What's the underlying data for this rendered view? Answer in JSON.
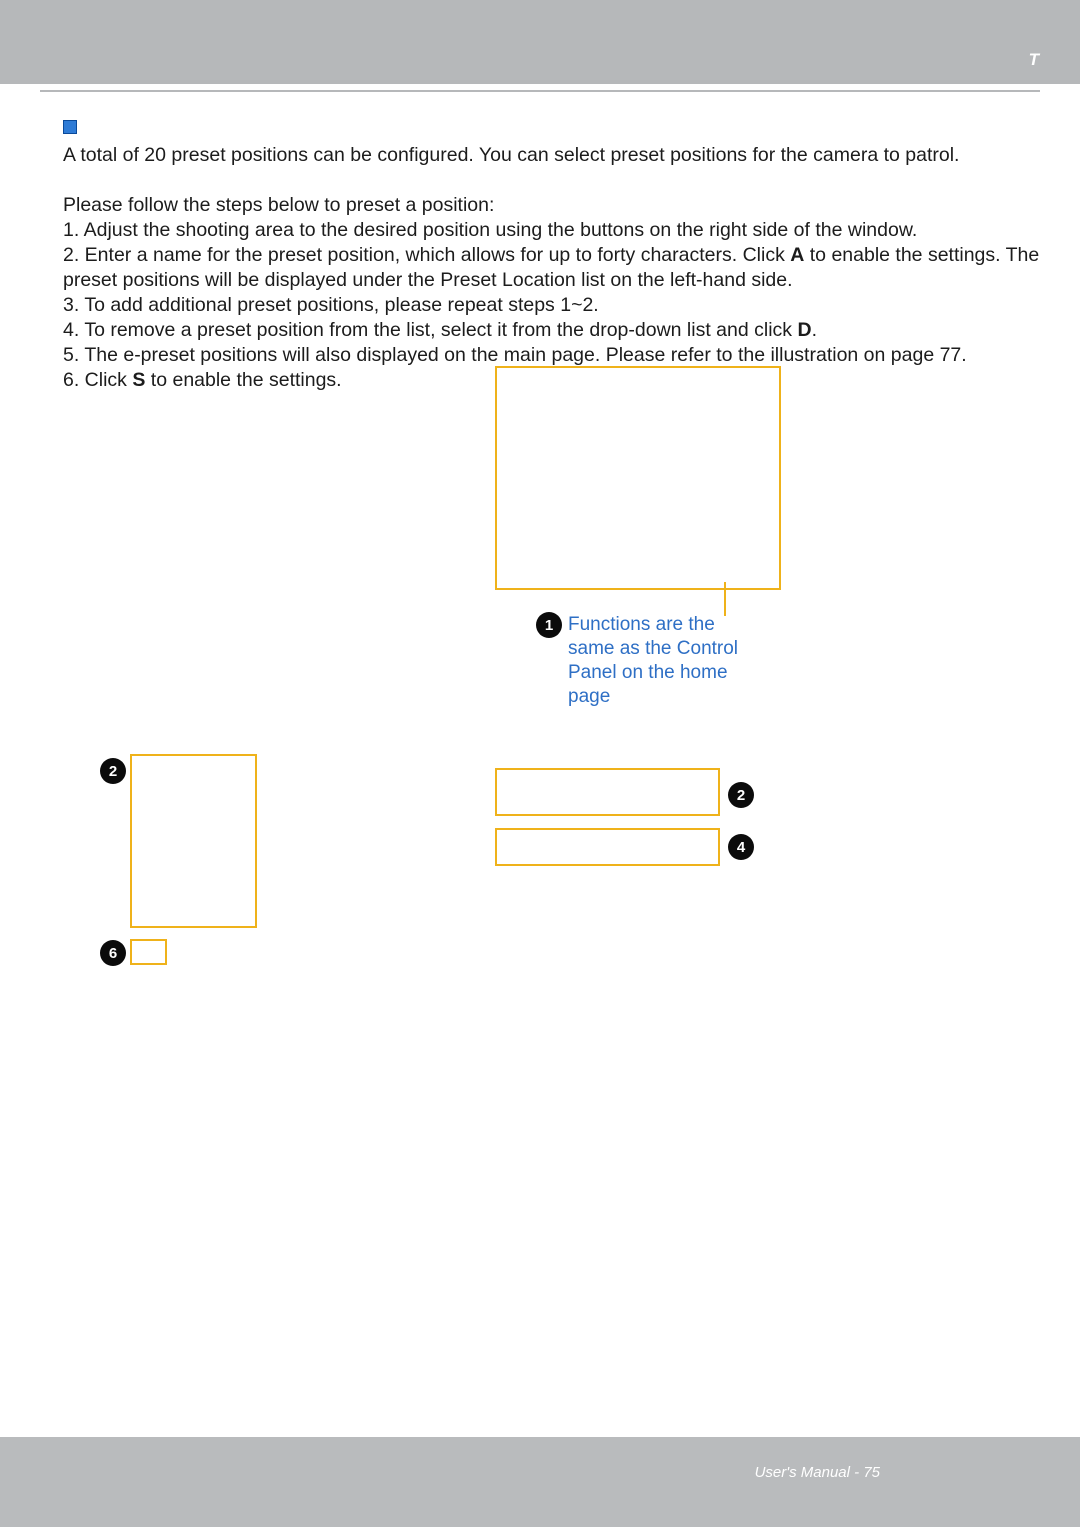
{
  "header": {
    "section_title": "T"
  },
  "intro_line": "A total of 20 preset positions can be configured. You can select preset positions for the camera to patrol.",
  "steps_intro": "Please follow the steps below to preset a position:",
  "steps": {
    "s1": "1. Adjust the shooting area to the desired position using the buttons on the right side of the window.",
    "s2_a": "2. Enter a name for the preset position, which allows for up to forty characters. Click ",
    "s2_marker": "A",
    "s2_b": " to enable the settings. The preset positions will be displayed under the Preset Location list on the left-hand side.",
    "s3": "3. To add additional preset positions, please repeat steps 1~2.",
    "s4_a": "4. To remove a preset position from the list, select it from the drop-down list and click ",
    "s4_marker": "D",
    "s4_b": ".",
    "s5": "5. The e-preset positions will also displayed on the main page. Please refer to the illustration on page 77.",
    "s6_a": "6. Click ",
    "s6_marker": "S",
    "s6_b": " to enable the settings."
  },
  "badges": {
    "b1": "1",
    "b2": "2",
    "b2b": "2",
    "b4": "4",
    "b6": "6"
  },
  "annotation": "Functions are the same as the Control Panel on the home page",
  "footer": {
    "label": "User's Manual - ",
    "page": "75"
  }
}
